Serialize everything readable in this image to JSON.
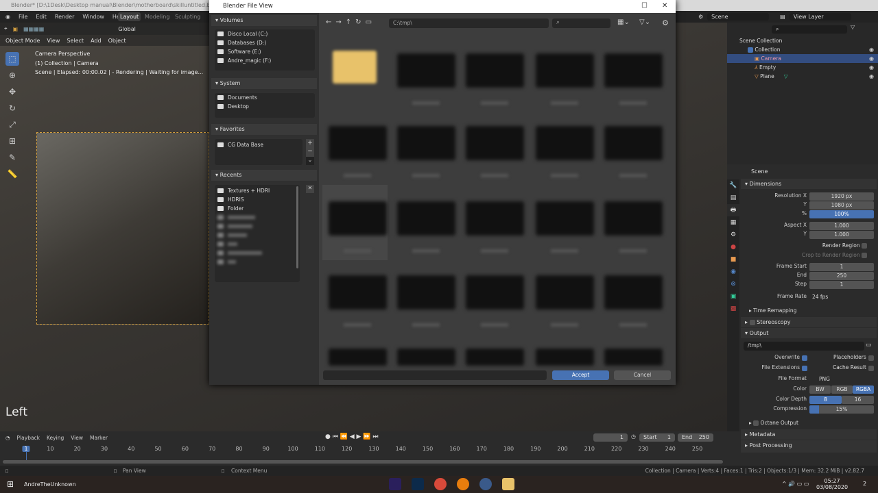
{
  "window": {
    "title": "Blender* [D:\\1Desk\\Desktop manual\\Blender\\motherboard\\skilluntitled.blend]"
  },
  "menu": [
    "File",
    "Edit",
    "Render",
    "Window",
    "Help"
  ],
  "workspaces": [
    {
      "label": "Layout",
      "active": true
    },
    {
      "label": "Modeling"
    },
    {
      "label": "Sculpting"
    }
  ],
  "viewport": {
    "orientation": "Global",
    "mode": "Object Mode",
    "menus": [
      "View",
      "Select",
      "Add",
      "Object"
    ],
    "info": [
      "Camera Perspective",
      "(1) Collection | Camera",
      "Scene | Elapsed: 00:00.02 | - Rendering | Waiting for image..."
    ],
    "view_label": "Left"
  },
  "dialog": {
    "title": "Blender File View",
    "path": "C:\\tmp\\",
    "volumes": {
      "title": "Volumes",
      "items": [
        "Disco Local (C:)",
        "Databases (D:)",
        "Software (E:)",
        "Andre_magic (F:)"
      ]
    },
    "system": {
      "title": "System",
      "items": [
        "Documents",
        "Desktop"
      ]
    },
    "favorites": {
      "title": "Favorites",
      "items": [
        "CG Data Base"
      ]
    },
    "recents": {
      "title": "Recents",
      "items": [
        "Textures + HDRI",
        "HDRIS",
        "Folder"
      ]
    },
    "accept": "Accept",
    "cancel": "Cancel",
    "accent": "#4772b3"
  },
  "topright": {
    "scene": "Scene",
    "view_layer": "View Layer"
  },
  "outliner": {
    "root": "Scene Collection",
    "collection": "Collection",
    "objects": [
      {
        "name": "Camera",
        "selected": true
      },
      {
        "name": "Empty"
      },
      {
        "name": "Plane"
      }
    ]
  },
  "properties": {
    "context": "Scene",
    "dimensions": {
      "title": "Dimensions",
      "res_x_label": "Resolution X",
      "res_x": "1920 px",
      "y_label": "Y",
      "res_y": "1080 px",
      "pct_label": "%",
      "pct": "100%",
      "aspect_x_label": "Aspect X",
      "aspect_x": "1.000",
      "aspect_y": "1.000",
      "render_region": "Render Region",
      "crop": "Crop to Render Region",
      "frame_start_label": "Frame Start",
      "frame_start": "1",
      "end_label": "End",
      "end": "250",
      "step_label": "Step",
      "step": "1",
      "rate_label": "Frame Rate",
      "rate": "24 fps",
      "time_remap": "Time Remapping"
    },
    "stereoscopy": "Stereoscopy",
    "output": {
      "title": "Output",
      "path": "/tmp\\",
      "overwrite": "Overwrite",
      "placeholders": "Placeholders",
      "file_ext": "File Extensions",
      "cache": "Cache Result",
      "format_label": "File Format",
      "format": "PNG",
      "color_label": "Color",
      "colors": [
        "BW",
        "RGB",
        "RGBA"
      ],
      "depth_label": "Color Depth",
      "depths": [
        "8",
        "16"
      ],
      "compression_label": "Compression",
      "compression": "15%",
      "compression_value": 15,
      "octane": "Octane Output"
    },
    "metadata": "Metadata",
    "post": "Post Processing"
  },
  "timeline": {
    "menus": [
      "Playback",
      "Keying",
      "View",
      "Marker"
    ],
    "current": "1",
    "start_label": "Start",
    "start": "1",
    "end_label": "End",
    "end": "250",
    "ticks": [
      "1",
      "10",
      "20",
      "30",
      "40",
      "50",
      "60",
      "70",
      "80",
      "90",
      "100",
      "110",
      "120",
      "130",
      "140",
      "150",
      "160",
      "170",
      "180",
      "190",
      "200",
      "210",
      "220",
      "230",
      "240",
      "250"
    ]
  },
  "status": {
    "pan": "Pan View",
    "context": "Context Menu",
    "stats": "Collection | Camera | Verts:4 | Faces:1 | Tris:2 | Objects:1/3 | Mem: 32.2 MiB | v2.82.7"
  },
  "taskbar": {
    "user": "AndreTheUnknown",
    "time": "05:27",
    "date": "03/08/2020",
    "notifications": "2"
  }
}
